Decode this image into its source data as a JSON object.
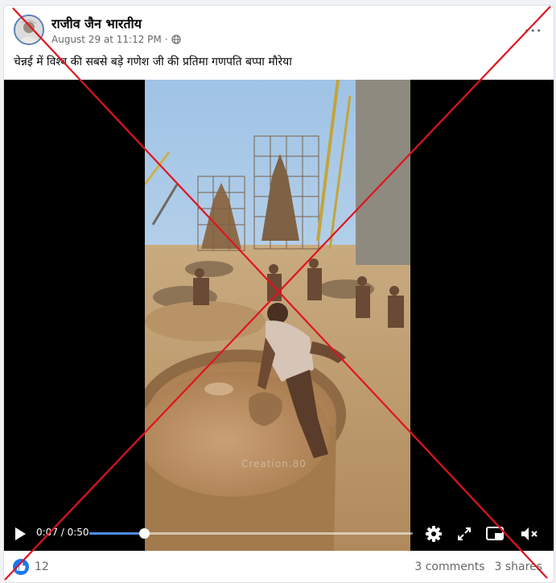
{
  "post": {
    "author": "राजीव जैन भारतीय",
    "timestamp": "August 29 at 11:12 PM",
    "separator": "·",
    "more_label": "•••",
    "caption": "चेन्नई में विश्व की सबसे बड़े गणेश जी की प्रतिमा गणपति बप्पा मौरेया"
  },
  "video": {
    "time": "0:07 / 0:50",
    "progress_fraction": 0.17,
    "watermark": "Creation.80",
    "accent_color": "#4e8cf5"
  },
  "reactions": {
    "likes": "12",
    "comments": "3 comments",
    "shares": "3 shares"
  },
  "overlay": {
    "cross_color": "#e0141e"
  }
}
